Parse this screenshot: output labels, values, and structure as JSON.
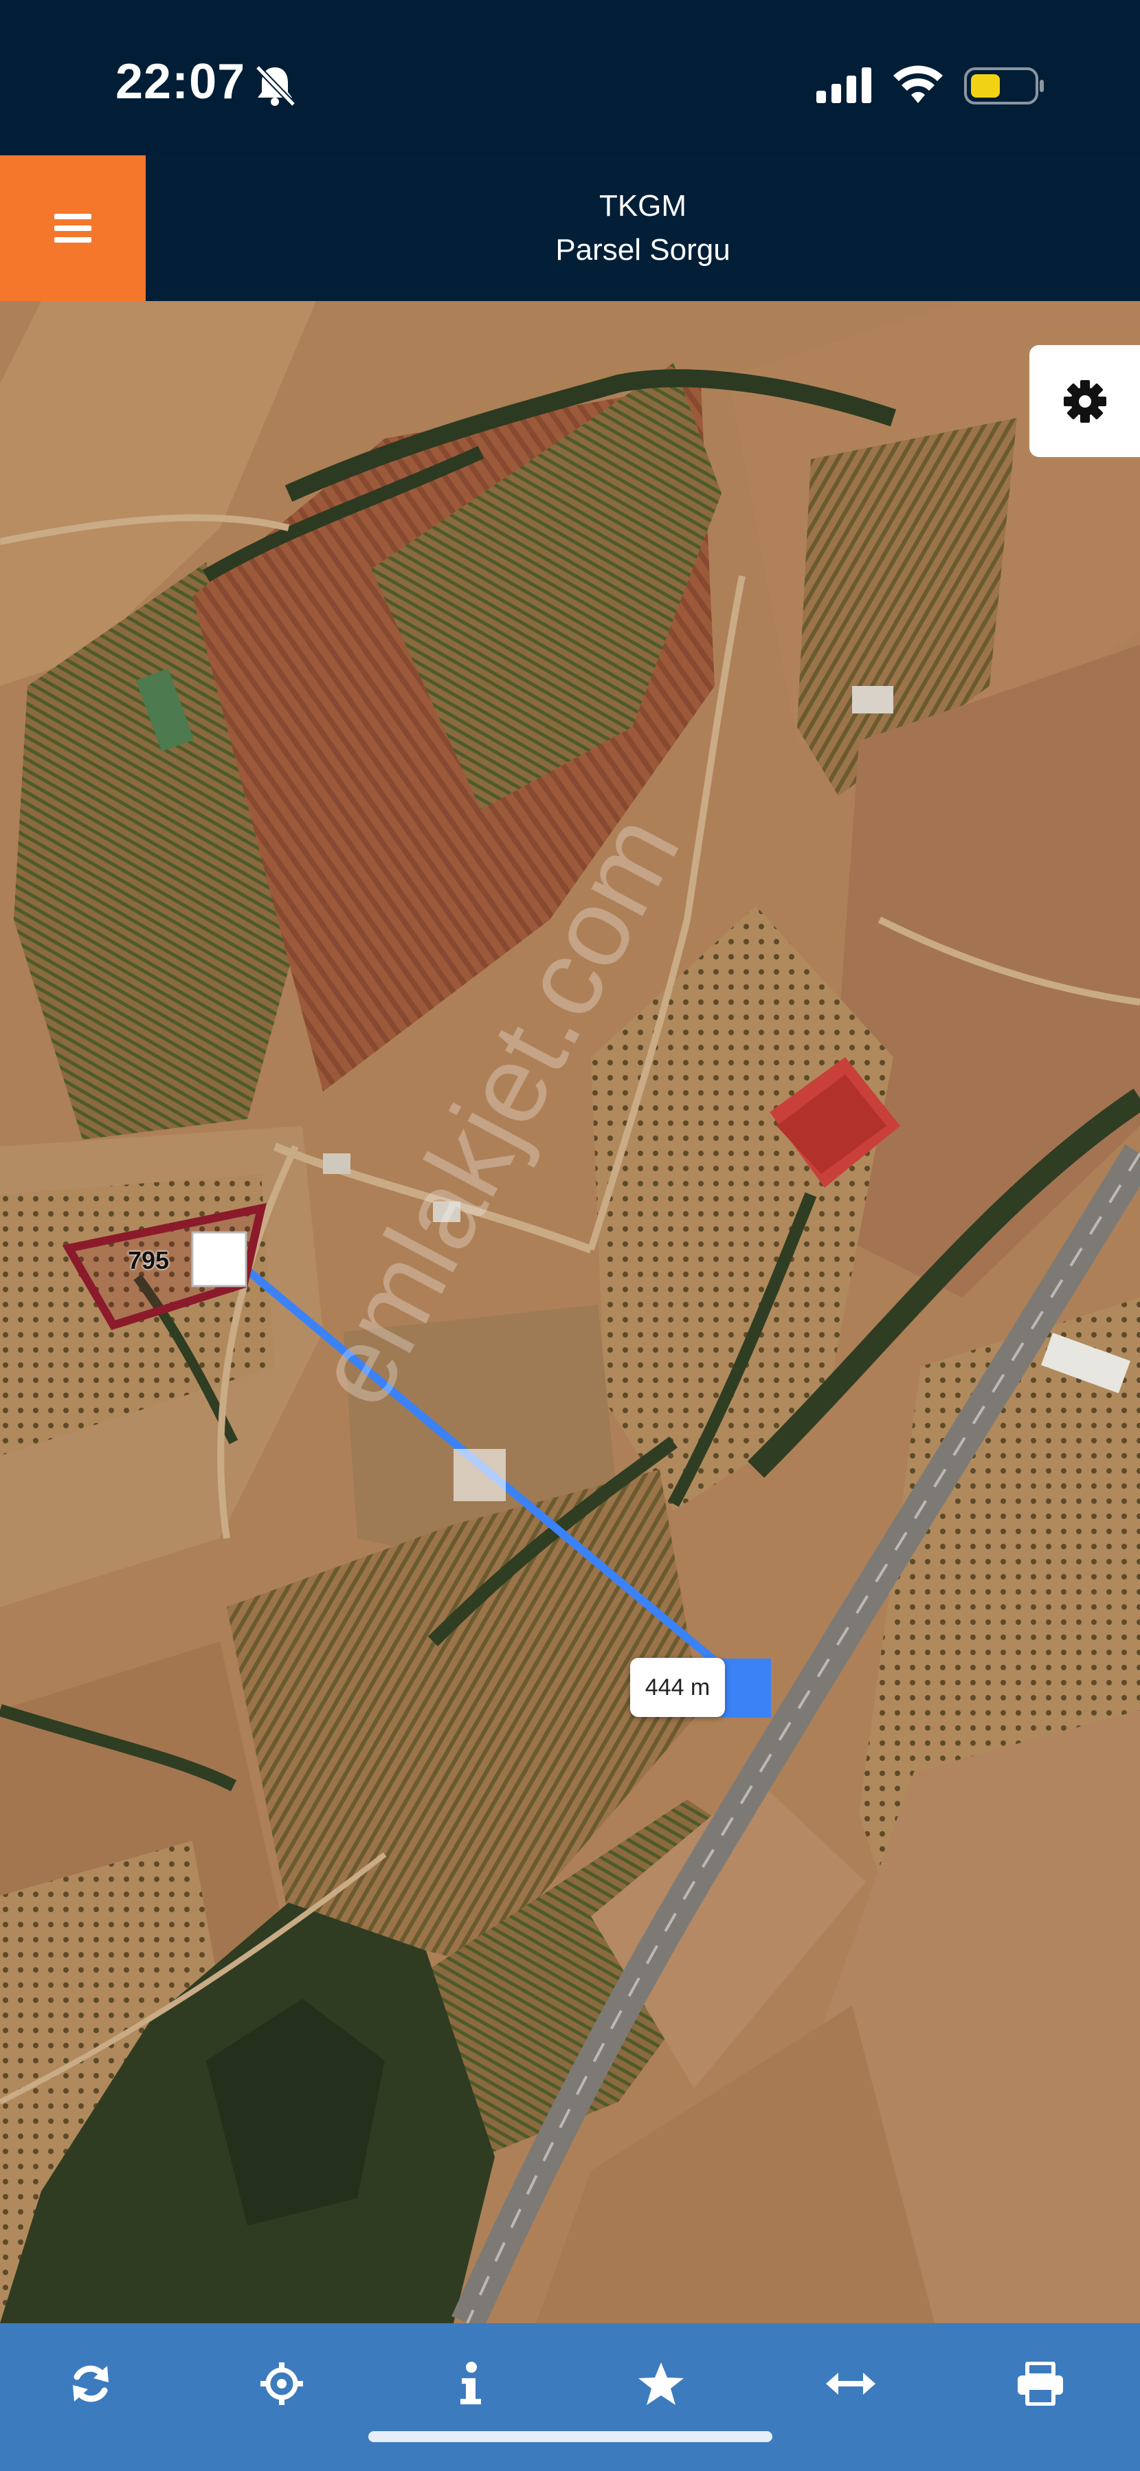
{
  "status_bar": {
    "time": "22:07"
  },
  "header": {
    "title": "TKGM",
    "subtitle": "Parsel Sorgu"
  },
  "map": {
    "parcel_label": "795",
    "distance_label": "444 m",
    "watermark": "emlakjet.com"
  },
  "icons": {
    "menu": "hamburger-icon",
    "settings": "gear-icon",
    "toolbar": [
      "refresh-icon",
      "crosshair-icon",
      "info-icon",
      "star-icon",
      "measure-icon",
      "print-icon"
    ]
  },
  "colors": {
    "header_bg": "#021f37",
    "menu_button_bg": "#f5772b",
    "toolbar_bg": "#3d7bbf",
    "parcel_outline": "#8b1a2b",
    "measure_line": "#3b82f6"
  }
}
